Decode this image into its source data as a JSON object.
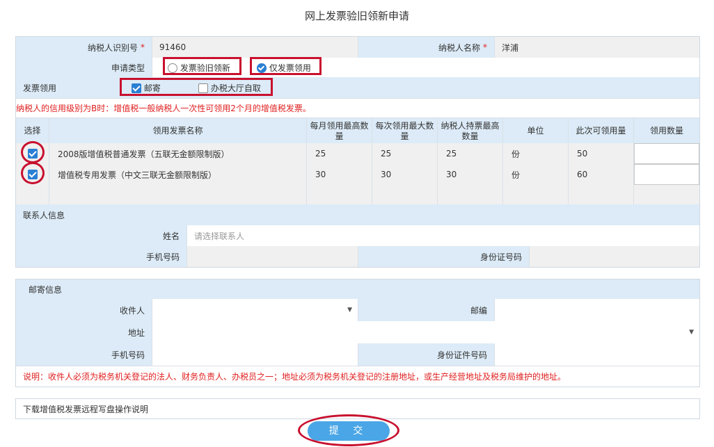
{
  "page_title": "网上发票验旧领新申请",
  "taxpayer": {
    "id_label": "纳税人识别号",
    "id_value": "91460",
    "name_label": "纳税人名称",
    "name_value": "洋浦",
    "required_mark": "*"
  },
  "apply_type": {
    "label": "申请类型",
    "option1": "发票验旧领新",
    "option2": "仅发票领用",
    "selected": "仅发票领用"
  },
  "invoice_receive": {
    "label": "发票领用",
    "option1": "邮寄",
    "option2": "办税大厅自取",
    "checked": "邮寄"
  },
  "notice_credit": "纳税人的信用级别为B时：增值税一般纳税人一次性可领用2个月的增值税发票。",
  "invoice_table": {
    "headers": [
      "选择",
      "领用发票名称",
      "每月领用最高数量",
      "每次领用最大数量",
      "纳税人持票最高数量",
      "单位",
      "此次可领用量",
      "领用数量"
    ],
    "header_lines": {
      "h2a": "每月领用最高数",
      "h2b": "量",
      "h3a": "每次领用最大数",
      "h3b": "量",
      "h4a": "纳税人持票最高",
      "h4b": "数量"
    },
    "rows": [
      {
        "name": "2008版增值税普通发票（五联无金额限制版）",
        "monthly_max": "25",
        "per_max": "25",
        "hold_max": "25",
        "unit": "份",
        "available": "50",
        "qty": ""
      },
      {
        "name": "增值税专用发票（中文三联无金额限制版）",
        "monthly_max": "30",
        "per_max": "30",
        "hold_max": "30",
        "unit": "份",
        "available": "60",
        "qty": ""
      }
    ]
  },
  "contact": {
    "section_label": "联系人信息",
    "name_label": "姓名",
    "name_placeholder": "请选择联系人",
    "phone_label": "手机号码",
    "id_label": "身份证号码"
  },
  "mail": {
    "section_label": "邮寄信息",
    "receiver_label": "收件人",
    "postcode_label": "邮编",
    "address_label": "地址",
    "phone_label": "手机号码",
    "id_label": "身份证件号码",
    "note": "说明：收件人必须为税务机关登记的法人、财务负责人、办税员之一；地址必须为税务机关登记的注册地址，或生产经营地址及税务局维护的地址。"
  },
  "download_link": "下载增值税发票远程写盘操作说明",
  "submit_label": "提 交",
  "colors": {
    "label_bg": "#dcebf7",
    "value_bg": "#f0f0f0",
    "accent": "#4aa6e6",
    "annotation_red": "#c8102e",
    "notice_red": "#e02020"
  }
}
